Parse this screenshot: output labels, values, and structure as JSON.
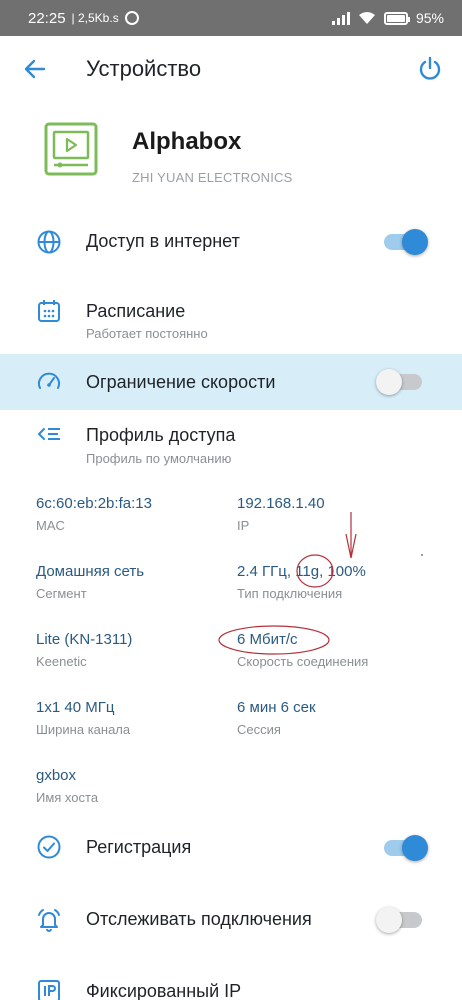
{
  "status_bar": {
    "time": "22:25",
    "net_speed": "| 2,5Kb.s",
    "battery": "95%"
  },
  "header": {
    "title": "Устройство"
  },
  "device": {
    "name": "Alphabox",
    "vendor": "ZHI YUAN ELECTRONICS"
  },
  "rows": {
    "internet": {
      "label": "Доступ в интернет",
      "toggle": "on"
    },
    "schedule": {
      "label": "Расписание",
      "sub": "Работает постоянно"
    },
    "speed_limit": {
      "label": "Ограничение скорости",
      "toggle": "off"
    },
    "access_profile": {
      "label": "Профиль доступа",
      "sub": "Профиль по умолчанию"
    },
    "registration": {
      "label": "Регистрация",
      "toggle": "on"
    },
    "track": {
      "label": "Отслеживать подключения",
      "toggle": "off"
    },
    "fixed_ip": {
      "label": "Фиксированный IP"
    }
  },
  "info": {
    "mac": {
      "value": "6c:60:eb:2b:fa:13",
      "caption": "MAC"
    },
    "ip": {
      "value": "192.168.1.40",
      "caption": "IP"
    },
    "segment": {
      "value": "Домашняя сеть",
      "caption": "Сегмент"
    },
    "conn_type": {
      "value": "2.4 ГГц, 11g, 100%",
      "caption": "Тип подключения"
    },
    "keenetic": {
      "value": "Lite (KN-1311)",
      "caption": "Keenetic"
    },
    "speed": {
      "value": "6 Мбит/с",
      "caption": "Скорость соединения"
    },
    "channel": {
      "value": "1x1 40 МГц",
      "caption": "Ширина канала"
    },
    "session": {
      "value": "6 мин 6 сек",
      "caption": "Сессия"
    },
    "hostname": {
      "value": "gxbox",
      "caption": "Имя хоста"
    }
  },
  "colors": {
    "accent": "#2f8ad8",
    "highlight_row": "#d7eef8",
    "value_text": "#2a5a82",
    "annotation": "#b5303a"
  },
  "icons": {
    "back": "arrow-left-icon",
    "power": "power-icon",
    "device": "tv-player-icon",
    "internet": "globe-icon",
    "schedule": "calendar-icon",
    "speed": "speedometer-icon",
    "profile": "list-icon",
    "registration": "check-circle-icon",
    "track": "alarm-bell-icon",
    "fixed_ip": "ip-badge-icon"
  }
}
